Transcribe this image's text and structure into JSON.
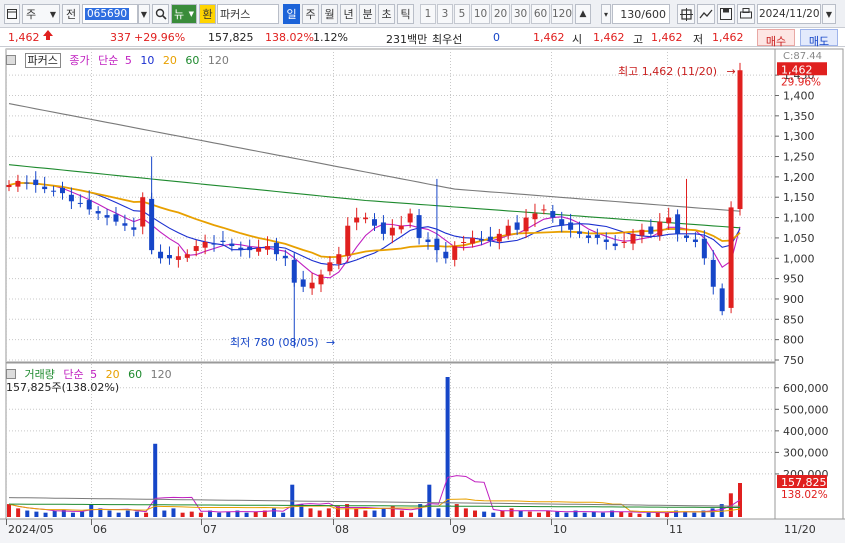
{
  "toolbar": {
    "market_label": "주",
    "jeon_label": "전",
    "stock_code": "065690",
    "news_label": "뉴",
    "hwan_label": "환",
    "stock_name": "파커스",
    "periods": [
      "일",
      "주",
      "월",
      "년",
      "분",
      "초",
      "틱"
    ],
    "active_period": "일",
    "intervals": [
      "1",
      "3",
      "5",
      "10",
      "20",
      "30",
      "60",
      "120"
    ],
    "bar_count": "130",
    "bar_total": "/600",
    "date": "2024/11/20"
  },
  "quote": {
    "price": "1,462",
    "change": "337",
    "change_pct": "+29.96%",
    "volume": "157,825",
    "volume_ratio": "138.02%",
    "turnover": "1.12%",
    "amount": "231백만",
    "priority_label": "최우선",
    "priority_value": "0",
    "last": "1,462",
    "open_label": "시",
    "open": "1,462",
    "high_label": "고",
    "high": "1,462",
    "low_label": "저",
    "low": "1,462",
    "buy_label": "매수",
    "sell_label": "매도"
  },
  "legend_price": {
    "name": "파커스",
    "close_label": "종가",
    "ma_label": "단순",
    "periods": [
      "5",
      "10",
      "20",
      "60",
      "120"
    ],
    "colors": [
      "#c01fc0",
      "#1b2fd0",
      "#e8a000",
      "#1e8a2e",
      "#7a7a7a"
    ]
  },
  "legend_volume": {
    "name": "거래량",
    "ma_label": "단순",
    "periods": [
      "5",
      "20",
      "60",
      "120"
    ],
    "colors": [
      "#c01fc0",
      "#e8a000",
      "#1e8a2e",
      "#7a7a7a"
    ],
    "volume_text": "157,825주(138.02%)"
  },
  "annotations": {
    "high_text": "최고 1,462 (11/20)",
    "low_text": "최저 780 (08/05)",
    "high_arrow": "→",
    "low_arrow": "→"
  },
  "price_axis": {
    "labels": [
      "1,450",
      "1,400",
      "1,350",
      "1,300",
      "1,250",
      "1,200",
      "1,150",
      "1,100",
      "1,050",
      "1,000",
      "950",
      "900",
      "850",
      "800",
      "750"
    ],
    "current_price_tag": "1,462",
    "current_pct_tag": "29.96%",
    "top_label": "C:87.44"
  },
  "volume_axis": {
    "labels": [
      "600,000",
      "500,000",
      "400,000",
      "300,000",
      "200,000"
    ],
    "current_tag": "157,825",
    "current_pct": "138.02%"
  },
  "x_axis": {
    "labels": [
      "2024/05",
      "06",
      "07",
      "08",
      "09",
      "10",
      "11"
    ],
    "right_label": "11/20"
  },
  "colors": {
    "up": "#e0201f",
    "down": "#1646c8",
    "accent": "#1c63d8",
    "grid": "#c8c8c8"
  },
  "chart_data": {
    "type": "candlestick",
    "x": [
      "2024/05",
      "06",
      "07",
      "08",
      "09",
      "10",
      "11",
      "11/20"
    ],
    "price_ylim": [
      750,
      1470
    ],
    "volume_ylim": [
      0,
      650000
    ],
    "high": {
      "value": 1462,
      "date": "11/20"
    },
    "low": {
      "value": 780,
      "date": "08/05"
    },
    "close_series": [
      1180,
      1190,
      1185,
      1180,
      1170,
      1165,
      1160,
      1140,
      1135,
      1120,
      1110,
      1100,
      1090,
      1080,
      1070,
      1150,
      1020,
      1000,
      1000,
      1005,
      1010,
      1030,
      1040,
      1035,
      1040,
      1030,
      1020,
      1020,
      1025,
      1030,
      1010,
      1000,
      940,
      930,
      940,
      960,
      990,
      1010,
      1080,
      1100,
      1100,
      1080,
      1060,
      1075,
      1080,
      1110,
      1050,
      1040,
      1020,
      1000,
      1030,
      1040,
      1050,
      1045,
      1045,
      1060,
      1080,
      1070,
      1100,
      1110,
      1120,
      1100,
      1080,
      1070,
      1060,
      1050,
      1050,
      1040,
      1030,
      1040,
      1060,
      1070,
      1060,
      1090,
      1100,
      1060,
      1050,
      1040,
      1000,
      930,
      870,
      1125,
      1462
    ],
    "volume_series": [
      60000,
      40000,
      30000,
      25000,
      20000,
      30000,
      35000,
      20000,
      25000,
      60000,
      40000,
      30000,
      20000,
      30000,
      25000,
      20000,
      340000,
      30000,
      40000,
      20000,
      25000,
      20000,
      30000,
      20000,
      25000,
      30000,
      20000,
      25000,
      30000,
      40000,
      20000,
      150000,
      60000,
      40000,
      30000,
      40000,
      50000,
      60000,
      40000,
      30000,
      30000,
      40000,
      50000,
      30000,
      20000,
      60000,
      150000,
      40000,
      650000,
      60000,
      40000,
      30000,
      25000,
      20000,
      30000,
      40000,
      30000,
      25000,
      20000,
      30000,
      25000,
      20000,
      30000,
      20000,
      25000,
      20000,
      30000,
      25000,
      20000,
      15000,
      20000,
      25000,
      20000,
      30000,
      25000,
      20000,
      30000,
      40000,
      60000,
      110000,
      157825
    ]
  }
}
